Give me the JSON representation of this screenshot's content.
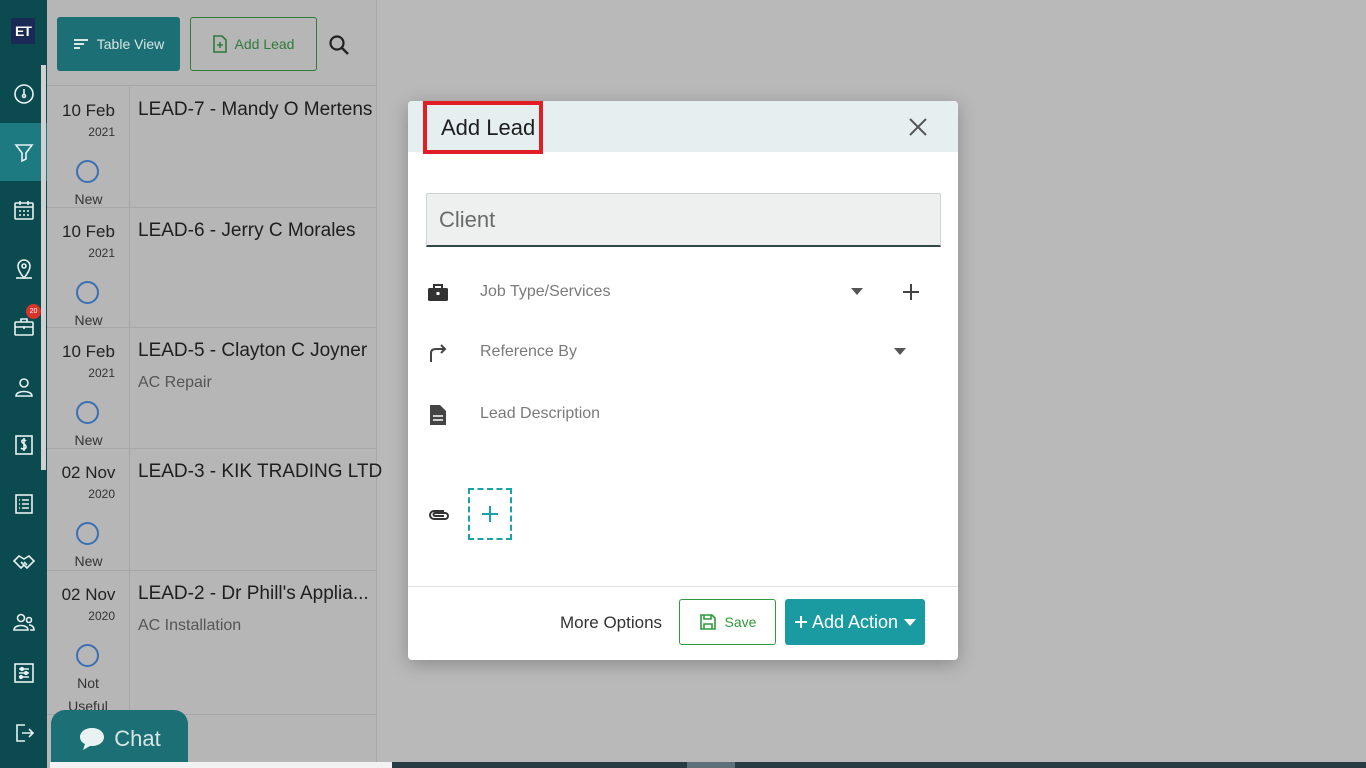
{
  "app": {
    "logo_text": "ET"
  },
  "nav": {
    "items": [
      {
        "icon": "dashboard-icon"
      },
      {
        "icon": "funnel-icon",
        "active": true
      },
      {
        "icon": "calendar-icon"
      },
      {
        "icon": "map-pin-icon"
      },
      {
        "icon": "briefcase-icon",
        "badge": "20"
      },
      {
        "icon": "user-icon"
      },
      {
        "icon": "dollar-icon"
      },
      {
        "icon": "list-icon"
      },
      {
        "icon": "handshake-icon"
      },
      {
        "icon": "users-icon"
      },
      {
        "icon": "sliders-icon"
      },
      {
        "icon": "logout-icon"
      }
    ]
  },
  "toolbar": {
    "table_view_label": "Table View",
    "add_lead_label": "Add Lead"
  },
  "leads": [
    {
      "day": "10 Feb",
      "year": "2021",
      "title": "LEAD-7 - Mandy O Mertens",
      "sub": "",
      "status": "New"
    },
    {
      "day": "10 Feb",
      "year": "2021",
      "title": "LEAD-6 - Jerry C Morales",
      "sub": "",
      "status": "New"
    },
    {
      "day": "10 Feb",
      "year": "2021",
      "title": "LEAD-5 - Clayton C Joyner",
      "sub": "AC Repair",
      "status": "New"
    },
    {
      "day": "02 Nov",
      "year": "2020",
      "title": "LEAD-3 - KIK TRADING LTD",
      "sub": "",
      "status": "New"
    },
    {
      "day": "02 Nov",
      "year": "2020",
      "title": "LEAD-2 - Dr Phill's Applia...",
      "sub": "AC Installation",
      "status": "Not Useful"
    }
  ],
  "chat": {
    "label": "Chat"
  },
  "modal": {
    "title": "Add Lead",
    "client_placeholder": "Client",
    "job_type_label": "Job Type/Services",
    "reference_label": "Reference By",
    "description_label": "Lead Description",
    "more_options_label": "More Options",
    "save_label": "Save",
    "add_action_label": "Add Action"
  },
  "colors": {
    "rail": "#0b4a4f",
    "accent": "#1a9ba1",
    "save_green": "#2f9a3a",
    "highlight_red": "#e11d25"
  }
}
